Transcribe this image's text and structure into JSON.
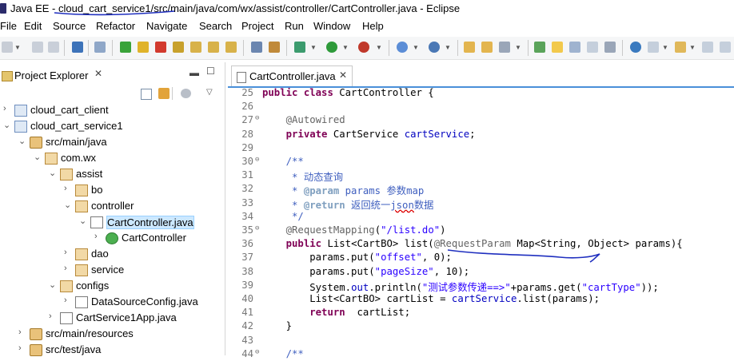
{
  "window": {
    "title": "Java EE - cloud_cart_service1/src/main/java/com/wx/assist/controller/CartController.java - Eclipse"
  },
  "menu": [
    "File",
    "Edit",
    "Source",
    "Refactor",
    "Navigate",
    "Search",
    "Project",
    "Run",
    "Window",
    "Help"
  ],
  "project_explorer": {
    "tab_label": "Project Explorer",
    "tree": [
      {
        "label": "cloud_cart_client",
        "depth": 0,
        "expanded": false,
        "icon": "project-icon"
      },
      {
        "label": "cloud_cart_service1",
        "depth": 0,
        "expanded": true,
        "icon": "project-icon"
      },
      {
        "label": "src/main/java",
        "depth": 1,
        "expanded": true,
        "icon": "source-folder-icon"
      },
      {
        "label": "com.wx",
        "depth": 2,
        "expanded": true,
        "icon": "package-icon"
      },
      {
        "label": "assist",
        "depth": 3,
        "expanded": true,
        "icon": "package-icon"
      },
      {
        "label": "bo",
        "depth": 4,
        "expanded": false,
        "icon": "package-icon"
      },
      {
        "label": "controller",
        "depth": 4,
        "expanded": true,
        "icon": "package-icon"
      },
      {
        "label": "CartController.java",
        "depth": 5,
        "expanded": true,
        "icon": "java-file-icon",
        "selected": true
      },
      {
        "label": "CartController",
        "depth": 6,
        "expanded": false,
        "icon": "class-icon"
      },
      {
        "label": "dao",
        "depth": 4,
        "expanded": false,
        "icon": "package-icon"
      },
      {
        "label": "service",
        "depth": 4,
        "expanded": false,
        "icon": "package-icon"
      },
      {
        "label": "configs",
        "depth": 3,
        "expanded": true,
        "icon": "package-icon"
      },
      {
        "label": "DataSourceConfig.java",
        "depth": 4,
        "expanded": false,
        "icon": "java-file-icon"
      },
      {
        "label": "CartService1App.java",
        "depth": 3,
        "expanded": false,
        "icon": "java-file-icon"
      },
      {
        "label": "src/main/resources",
        "depth": 1,
        "expanded": false,
        "icon": "source-folder-icon"
      },
      {
        "label": "src/test/java",
        "depth": 1,
        "expanded": false,
        "icon": "source-folder-icon"
      }
    ]
  },
  "editor": {
    "tab_label": "CartController.java",
    "lines": [
      {
        "n": "25",
        "fold": "",
        "tokens": [
          [
            "kw",
            "public "
          ],
          [
            "kw",
            "class "
          ],
          [
            "",
            "CartController {"
          ]
        ]
      },
      {
        "n": "26",
        "fold": "",
        "tokens": []
      },
      {
        "n": "27",
        "fold": "⊖",
        "tokens": [
          [
            "",
            "    "
          ],
          [
            "ann",
            "@Autowired"
          ]
        ]
      },
      {
        "n": "28",
        "fold": "",
        "tokens": [
          [
            "",
            "    "
          ],
          [
            "kw",
            "private "
          ],
          [
            "",
            "CartService "
          ],
          [
            "fld",
            "cartService"
          ],
          [
            "",
            ";"
          ]
        ]
      },
      {
        "n": "29",
        "fold": "",
        "tokens": []
      },
      {
        "n": "30",
        "fold": "⊖",
        "tokens": [
          [
            "cmt",
            "    /**"
          ]
        ]
      },
      {
        "n": "31",
        "fold": "",
        "tokens": [
          [
            "cmt",
            "     * 动态查询"
          ]
        ]
      },
      {
        "n": "32",
        "fold": "",
        "tokens": [
          [
            "cmt",
            "     * "
          ],
          [
            "cmt-tag",
            "@param"
          ],
          [
            "cmt",
            " params 参数map"
          ]
        ]
      },
      {
        "n": "33",
        "fold": "",
        "tokens": [
          [
            "cmt",
            "     * "
          ],
          [
            "cmt-tag",
            "@return"
          ],
          [
            "cmt",
            " 返回统一"
          ],
          [
            "cmt squig",
            "json"
          ],
          [
            "cmt",
            "数据"
          ]
        ]
      },
      {
        "n": "34",
        "fold": "",
        "tokens": [
          [
            "cmt",
            "     */"
          ]
        ]
      },
      {
        "n": "35",
        "fold": "⊖",
        "tokens": [
          [
            "",
            "    "
          ],
          [
            "ann",
            "@RequestMapping"
          ],
          [
            "",
            "("
          ],
          [
            "str",
            "\"/list.do\""
          ],
          [
            "",
            ")"
          ]
        ]
      },
      {
        "n": "36",
        "fold": "",
        "tokens": [
          [
            "",
            "    "
          ],
          [
            "kw",
            "public "
          ],
          [
            "",
            "List<CartBO> list("
          ],
          [
            "ann",
            "@RequestParam"
          ],
          [
            "",
            " Map<String, Object> params){"
          ]
        ]
      },
      {
        "n": "37",
        "fold": "",
        "tokens": [
          [
            "",
            "        params.put("
          ],
          [
            "str",
            "\"offset\""
          ],
          [
            "",
            ", 0);"
          ]
        ]
      },
      {
        "n": "38",
        "fold": "",
        "tokens": [
          [
            "",
            "        params.put("
          ],
          [
            "str",
            "\"pageSize\""
          ],
          [
            "",
            ", 10);"
          ]
        ]
      },
      {
        "n": "39",
        "fold": "",
        "tokens": [
          [
            "",
            "        System."
          ],
          [
            "fld",
            "out"
          ],
          [
            "",
            ".println("
          ],
          [
            "str",
            "\"测试参数传递==>\""
          ],
          [
            "",
            "+params.get("
          ],
          [
            "str",
            "\"cartType\""
          ],
          [
            "",
            "));"
          ]
        ]
      },
      {
        "n": "40",
        "fold": "",
        "tokens": [
          [
            "",
            "        List<CartBO> cartList = "
          ],
          [
            "fld",
            "cartService"
          ],
          [
            "",
            ".list(params);"
          ]
        ]
      },
      {
        "n": "41",
        "fold": "",
        "tokens": [
          [
            "",
            "        "
          ],
          [
            "kw",
            "return "
          ],
          [
            "",
            " cartList;"
          ]
        ]
      },
      {
        "n": "42",
        "fold": "",
        "tokens": [
          [
            "",
            "    }"
          ]
        ]
      },
      {
        "n": "43",
        "fold": "",
        "tokens": []
      },
      {
        "n": "44",
        "fold": "⊖",
        "tokens": [
          [
            "cmt",
            "    /**"
          ]
        ]
      }
    ]
  },
  "colors": {
    "keyword": "#7f0055",
    "annotation": "#646464",
    "field": "#0000c0",
    "string": "#2a00ff",
    "comment": "#3f5fbf",
    "ink": "#1f2fbf"
  }
}
